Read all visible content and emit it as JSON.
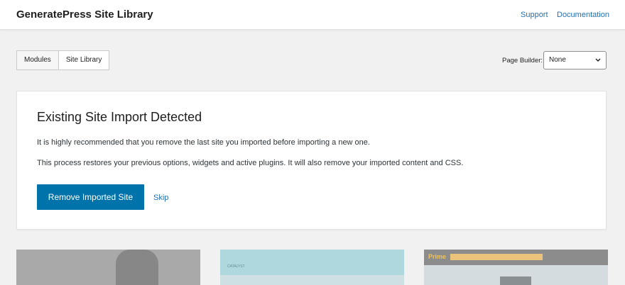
{
  "header": {
    "title": "GeneratePress Site Library",
    "links": [
      {
        "label": "Support"
      },
      {
        "label": "Documentation"
      }
    ]
  },
  "tabs": [
    {
      "label": "Modules",
      "active": false
    },
    {
      "label": "Site Library",
      "active": true
    }
  ],
  "page_builder": {
    "label": "Page Builder:",
    "selected": "None"
  },
  "notice": {
    "title": "Existing Site Import Detected",
    "paragraph1": "It is highly recommended that you remove the last site you imported before importing a new one.",
    "paragraph2": "This process restores your previous options, widgets and active plugins. It will also remove your imported content and CSS.",
    "remove_button": "Remove Imported Site",
    "skip_link": "Skip"
  },
  "site_thumbnails": [
    {
      "name": "",
      "color": "#a9a9a9"
    },
    {
      "name": "CATALYST",
      "color": "#cfe0e3"
    },
    {
      "name": "Prime",
      "color": "#d5dcdf"
    }
  ],
  "colors": {
    "accent": "#0073aa",
    "link": "#2271b1"
  }
}
